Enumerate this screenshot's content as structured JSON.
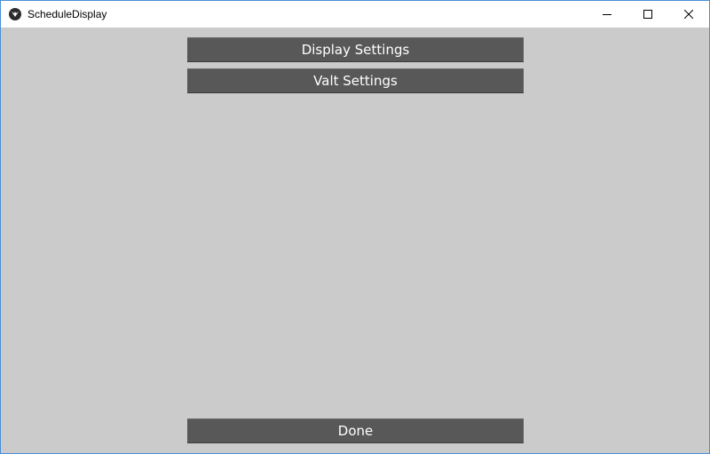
{
  "window": {
    "title": "ScheduleDisplay",
    "icon": "kivy-app-icon",
    "controls": [
      "minimize-icon",
      "maximize-icon",
      "close-icon"
    ]
  },
  "buttons": {
    "display_settings": "Display Settings",
    "valt_settings": "Valt Settings",
    "done": "Done"
  },
  "colors": {
    "background": "#cbcbcb",
    "button": "#585858",
    "button_text": "#ffffff",
    "titlebar": "#ffffff"
  }
}
